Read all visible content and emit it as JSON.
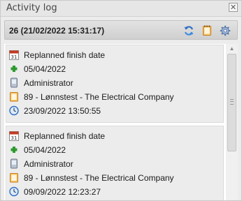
{
  "panel": {
    "title": "Activity log",
    "close_glyph": "✕"
  },
  "header": {
    "title": "26 (21/02/2022 15:31:17)",
    "icons": [
      "refresh-icon",
      "note-icon",
      "settings-icon"
    ]
  },
  "entries": [
    {
      "action": "Replanned finish date",
      "date": "05/04/2022",
      "user": "Administrator",
      "project": "89 - Lønnstest - The Electrical Company",
      "timestamp": "23/09/2022 13:50:55"
    },
    {
      "action": "Replanned finish date",
      "date": "05/04/2022",
      "user": "Administrator",
      "project": "89 - Lønnstest - The Electrical Company",
      "timestamp": "09/09/2022 12:23:27"
    }
  ],
  "colors": {
    "accent_blue": "#2f6fc4",
    "add_green": "#2e9a2e",
    "calendar_red": "#c23b22",
    "note_orange": "#e89a2c"
  }
}
